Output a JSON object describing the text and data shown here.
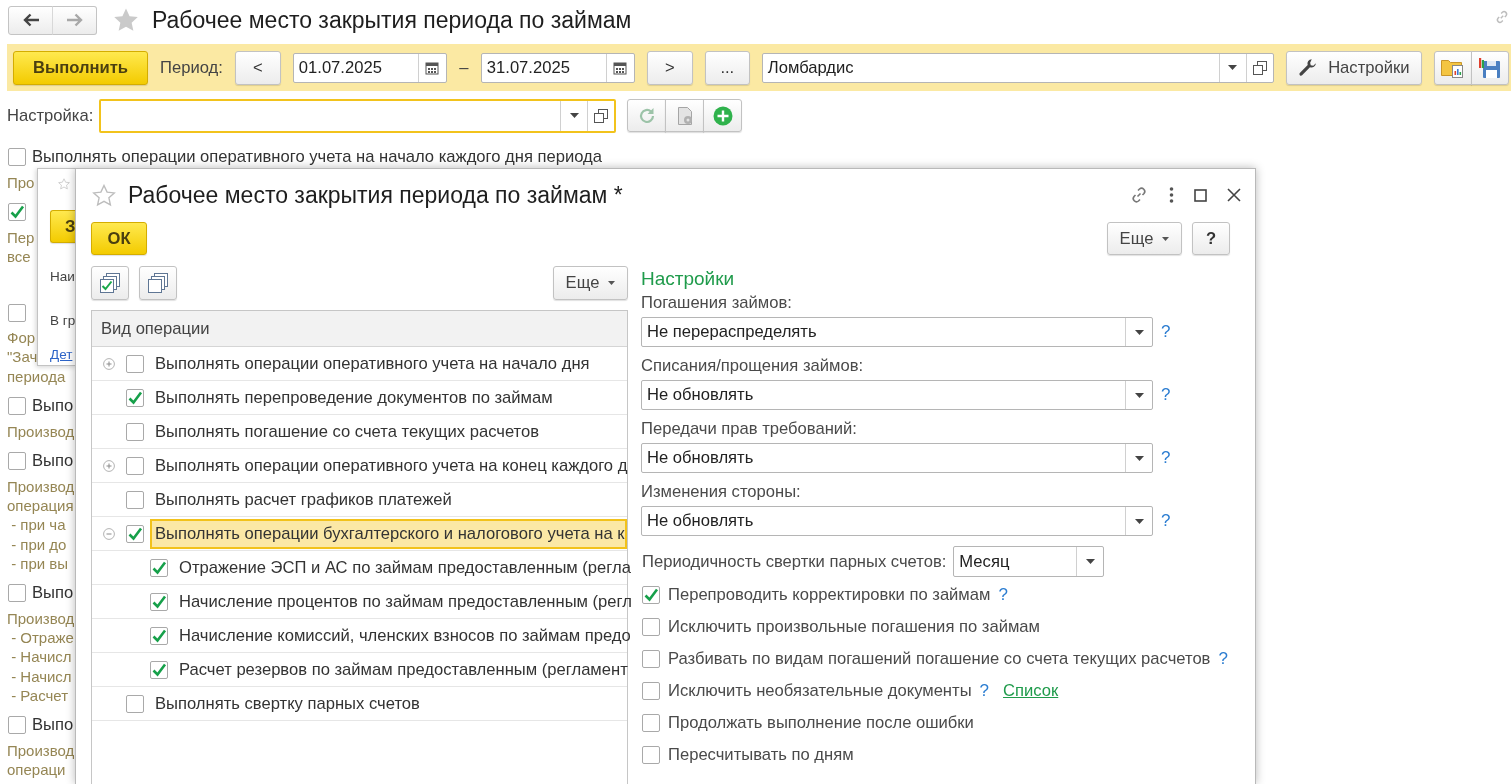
{
  "page": {
    "title": "Рабочее место закрытия периода по займам"
  },
  "nav": [
    {
      "kind": "back",
      "disabled": false
    },
    {
      "kind": "forward",
      "disabled": true
    }
  ],
  "toolbar": {
    "run_button": "Выполнить",
    "period_label": "Период:",
    "prev_button": "<",
    "date_from": "01.07.2025",
    "date_separator": "–",
    "date_to": "31.07.2025",
    "next_button": ">",
    "more_button": "...",
    "organization": "Ломбардис",
    "settings_button": "Настройки"
  },
  "setting_row": {
    "label": "Настройка:",
    "focused": true
  },
  "background_options": [
    {
      "checked": false,
      "label": "Выполнять операции оперативного учета на начало каждого дня периода",
      "hint": [
        "Про"
      ]
    },
    {
      "checked": true,
      "hint": [
        "Пер",
        "все"
      ]
    },
    {
      "checked": false,
      "hint": [
        "Фор",
        "\"Зач",
        "периода"
      ]
    },
    {
      "checked": false,
      "label": "Выпо",
      "hint": [
        "Производ"
      ]
    },
    {
      "checked": false,
      "label": "Выпо",
      "hint": [
        "Производ",
        "операция",
        " - при ча",
        " - при до",
        " - при вы"
      ]
    },
    {
      "checked": false,
      "label": "Выпо",
      "hint": [
        "Производ",
        " - Отраже",
        " - Начисл",
        " - Начисл",
        " - Расчет"
      ]
    },
    {
      "checked": false,
      "label": "Выпо",
      "hint": [
        "Производ",
        "операци"
      ]
    }
  ],
  "back_window": {
    "run_button": "З",
    "lines": [
      {
        "kind": "text",
        "text": "Наи"
      },
      {
        "kind": "text",
        "text": "В гр"
      },
      {
        "kind": "link",
        "text": "Дет"
      }
    ]
  },
  "dialog": {
    "title": "Рабочее место закрытия периода по займам *",
    "ok_button": "ОК",
    "more_button": "Еще",
    "help_button": "?",
    "list_toolbar": {
      "more_button": "Еще"
    },
    "table": {
      "column": "Вид операции",
      "rows": [
        {
          "kind": "group",
          "label": "Выполнять операции оперативного учета на начало дня",
          "checked": false,
          "expanded": false,
          "selected": false
        },
        {
          "kind": "item",
          "label": "Выполнять перепроведение документов по займам",
          "checked": true,
          "selected": false
        },
        {
          "kind": "item",
          "label": "Выполнять погашение со счета текущих расчетов",
          "checked": false,
          "selected": false
        },
        {
          "kind": "group",
          "label": "Выполнять операции оперативного учета на конец каждого д",
          "checked": false,
          "expanded": false,
          "selected": false
        },
        {
          "kind": "item",
          "label": "Выполнять расчет графиков платежей",
          "checked": false,
          "selected": false
        },
        {
          "kind": "group",
          "label": "Выполнять операции бухгалтерского и налогового учета на к",
          "checked": true,
          "expanded": true,
          "selected": true,
          "children": [
            {
              "kind": "item",
              "label": "Отражение ЭСП и АС по займам предоставленным (регла",
              "checked": true,
              "selected": false
            },
            {
              "kind": "item",
              "label": "Начисление процентов по займам предоставленным (регл",
              "checked": true,
              "selected": false
            },
            {
              "kind": "item",
              "label": "Начисление комиссий, членских взносов по займам предо",
              "checked": true,
              "selected": false
            },
            {
              "kind": "item",
              "label": "Расчет резервов по займам предоставленным (регламент",
              "checked": true,
              "selected": false
            }
          ]
        },
        {
          "kind": "item",
          "label": "Выполнять свертку парных счетов",
          "checked": false,
          "selected": false
        }
      ]
    },
    "settings": {
      "heading": "Настройки",
      "selects": [
        {
          "label": "Погашения займов:",
          "value": "Не перераспределять",
          "help": "?"
        },
        {
          "label": "Списания/прощения займов:",
          "value": "Не обновлять",
          "help": "?"
        },
        {
          "label": "Передачи прав требований:",
          "value": "Не обновлять",
          "help": "?"
        },
        {
          "label": "Изменения стороны:",
          "value": "Не обновлять",
          "help": "?"
        }
      ],
      "period": {
        "label": "Периодичность свертки парных счетов:",
        "value": "Месяц"
      },
      "options": [
        {
          "label": "Перепроводить корректировки по займам",
          "checked": true,
          "help": "?"
        },
        {
          "label": "Исключить произвольные погашения по займам",
          "checked": false
        },
        {
          "label": "Разбивать по видам погашений погашение со счета текущих расчетов",
          "checked": false,
          "help": "?"
        },
        {
          "label": "Исключить необязательные документы",
          "checked": false,
          "help": "?",
          "link": "Список"
        },
        {
          "label": "Продолжать выполнение после ошибки",
          "checked": false
        },
        {
          "label": "Пересчитывать по дням",
          "checked": false
        }
      ]
    }
  }
}
